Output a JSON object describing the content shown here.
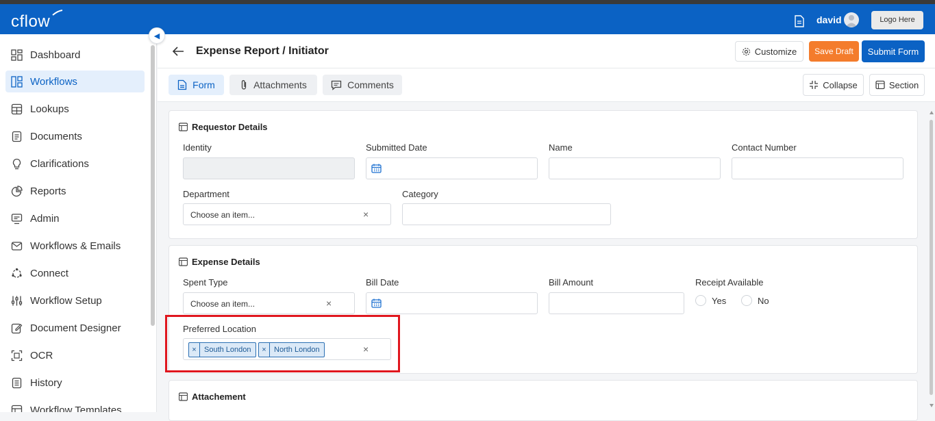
{
  "app": {
    "logo": "cflow",
    "user": "david",
    "logo_placeholder": "Logo Here"
  },
  "sidebar": {
    "items": [
      {
        "label": "Dashboard",
        "icon": "dashboard-icon",
        "active": false
      },
      {
        "label": "Workflows",
        "icon": "workflows-icon",
        "active": true
      },
      {
        "label": "Lookups",
        "icon": "table-icon",
        "active": false
      },
      {
        "label": "Documents",
        "icon": "document-icon",
        "active": false
      },
      {
        "label": "Clarifications",
        "icon": "lightbulb-icon",
        "active": false
      },
      {
        "label": "Reports",
        "icon": "pie-chart-icon",
        "active": false
      },
      {
        "label": "Admin",
        "icon": "monitor-icon",
        "active": false
      },
      {
        "label": "Workflows & Emails",
        "icon": "mail-icon",
        "active": false
      },
      {
        "label": "Connect",
        "icon": "connect-icon",
        "active": false
      },
      {
        "label": "Workflow Setup",
        "icon": "sliders-icon",
        "active": false
      },
      {
        "label": "Document Designer",
        "icon": "edit-icon",
        "active": false
      },
      {
        "label": "OCR",
        "icon": "scan-icon",
        "active": false
      },
      {
        "label": "History",
        "icon": "history-icon",
        "active": false
      },
      {
        "label": "Workflow Templates",
        "icon": "template-icon",
        "active": false
      }
    ]
  },
  "header": {
    "title": "Expense Report / Initiator",
    "customize": "Customize",
    "save_draft": "Save Draft",
    "submit": "Submit Form"
  },
  "tabs": {
    "form": "Form",
    "attachments": "Attachments",
    "comments": "Comments",
    "collapse": "Collapse",
    "section": "Section"
  },
  "requestor": {
    "title": "Requestor Details",
    "identity": "Identity",
    "submitted_date": "Submitted Date",
    "name": "Name",
    "contact": "Contact Number",
    "department": "Department",
    "department_placeholder": "Choose an item...",
    "category": "Category"
  },
  "expense": {
    "title": "Expense Details",
    "spent_type": "Spent Type",
    "spent_type_placeholder": "Choose an item...",
    "bill_date": "Bill Date",
    "bill_amount": "Bill Amount",
    "receipt_available": "Receipt Available",
    "yes": "Yes",
    "no": "No",
    "preferred_location": "Preferred Location",
    "locations": [
      "South London",
      "North London"
    ]
  },
  "attachment": {
    "title": "Attachement"
  },
  "colors": {
    "brand": "#0b62c4",
    "draft": "#f47c2c",
    "highlight": "#e0161e"
  }
}
